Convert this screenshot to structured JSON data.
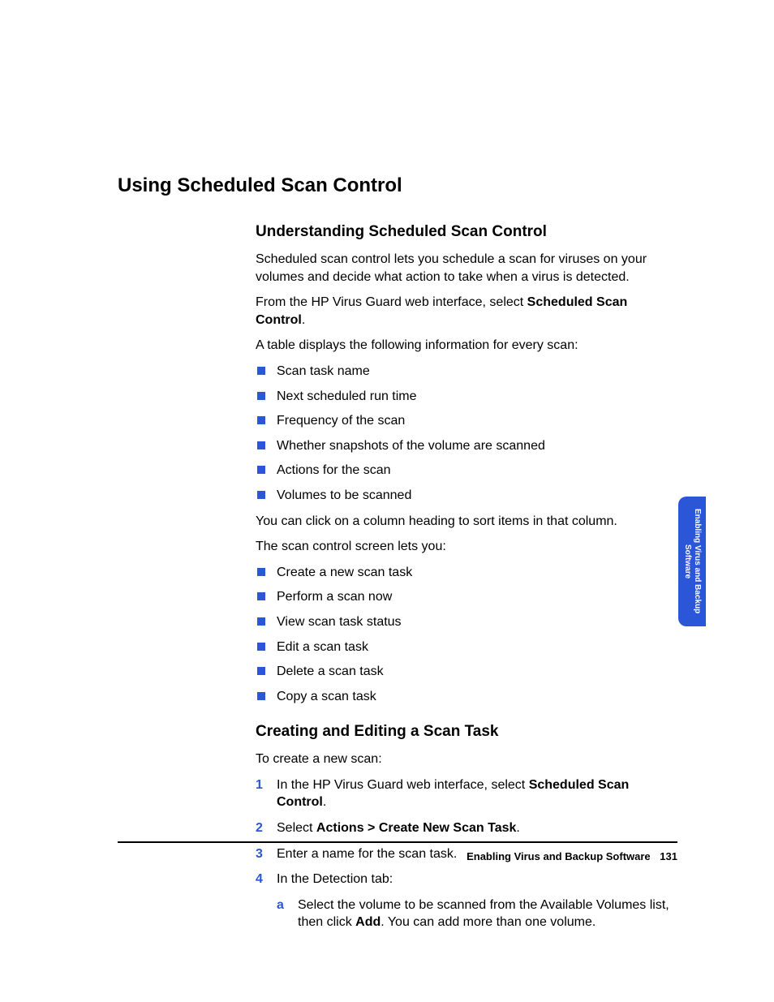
{
  "page_title": "Using Scheduled Scan Control",
  "section1": {
    "heading": "Understanding Scheduled Scan Control",
    "p1": "Scheduled scan control lets you schedule a scan for viruses on your volumes and decide what action to take when a virus is detected.",
    "p2_pre": "From the HP Virus Guard web interface, select ",
    "p2_bold": "Scheduled Scan Control",
    "p2_post": ".",
    "p3": "A table displays the following information for every scan:",
    "list1": [
      "Scan task name",
      "Next scheduled run time",
      "Frequency of the scan",
      "Whether snapshots of the volume are scanned",
      "Actions for the scan",
      "Volumes to be scanned"
    ],
    "p4": "You can click on a column heading to sort items in that column.",
    "p5": "The scan control screen lets you:",
    "list2": [
      "Create a new scan task",
      "Perform a scan now",
      "View scan task status",
      "Edit a scan task",
      "Delete a scan task",
      "Copy a scan task"
    ]
  },
  "section2": {
    "heading": "Creating and Editing a Scan Task",
    "intro": "To create a new scan:",
    "step1_pre": "In the HP Virus Guard web interface, select ",
    "step1_bold": "Scheduled Scan Control",
    "step1_post": ".",
    "step2_pre": "Select ",
    "step2_bold": "Actions > Create New Scan Task",
    "step2_post": ".",
    "step3": "Enter a name for the scan task.",
    "step4": "In the Detection tab:",
    "sub_a_marker": "a",
    "sub_a_pre": "Select the volume to be scanned from the Available Volumes list, then click ",
    "sub_a_bold": "Add",
    "sub_a_post": ". You can add more than one volume."
  },
  "side_tab_line1": "Enabling Virus and Backup",
  "side_tab_line2": "Software",
  "footer_title": "Enabling Virus and Backup Software",
  "footer_page": "131"
}
